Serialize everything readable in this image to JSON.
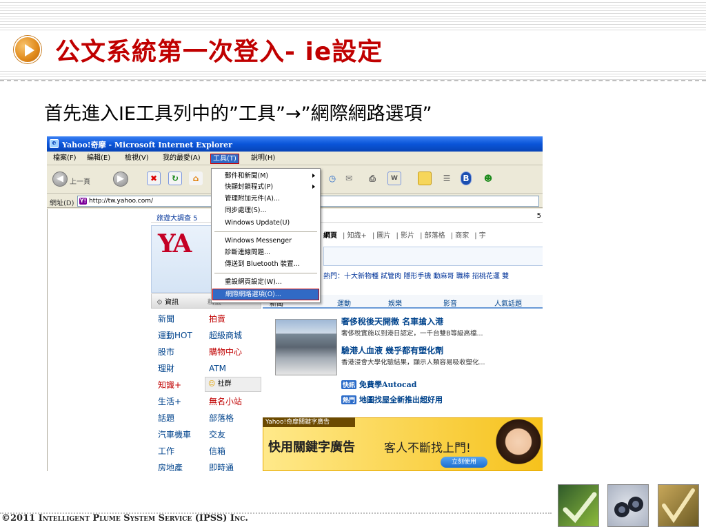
{
  "slide": {
    "title": "公文系統第一次登入- ie設定",
    "instruction": "首先進入IE工具列中的”工具”→”網際網路選項”",
    "footer": "©2011 Intelligent Plume System Service (IPSS) Inc."
  },
  "browser": {
    "window_title": "Yahoo!奇摩 - Microsoft Internet Explorer",
    "menu": [
      "檔案(F)",
      "編輯(E)",
      "檢視(V)",
      "我的最愛(A)",
      "工具(T)",
      "說明(H)"
    ],
    "toolbar": {
      "back_label": "上一頁"
    },
    "address": {
      "label": "網址(D)",
      "value": "http://tw.yahoo.com/"
    },
    "tools_menu": [
      {
        "label": "郵件和新聞(M)",
        "submenu": true
      },
      {
        "label": "快顯封鎖程式(P)",
        "submenu": true
      },
      {
        "label": "管理附加元件(A)..."
      },
      {
        "label": "同步處理(S)..."
      },
      {
        "label": "Windows Update(U)"
      },
      {
        "label": "Windows Messenger"
      },
      {
        "label": "診斷連線問題..."
      },
      {
        "label": "傳送到 Bluetooth 裝置..."
      },
      {
        "label": "重設網頁設定(W)..."
      },
      {
        "label": "網際網路選項(O)...",
        "highlighted": true
      }
    ]
  },
  "page": {
    "top_links": "旅遊大調查  5",
    "top_right": "5",
    "logo": "YA",
    "search_tabs": [
      "網頁",
      "知識+",
      "圖片",
      "影片",
      "部落格",
      "商家",
      "宇"
    ],
    "hot_line": "熱門：十大新物種 試管肉 隱形手機 動麻哥 職棒 招桃花運 雙",
    "categories_header": [
      "資訊",
      "精選"
    ],
    "left_column": [
      "新聞",
      "運動HOT",
      "股市",
      "理財",
      "知識+",
      "生活+",
      "話題",
      "汽車機車",
      "工作",
      "房地產"
    ],
    "right_column": [
      "拍賣",
      "超級商城",
      "購物中心",
      "ATM",
      "",
      "無名小站",
      "部落格",
      "交友",
      "信箱",
      "即時通"
    ],
    "community_label": "社群",
    "news_tabs": [
      "新聞",
      "運動",
      "娛樂",
      "影音",
      "人氣話題"
    ],
    "news": [
      {
        "headline": "奢侈稅後天開徵 名車搶入港",
        "sub": "奢侈稅實施以到港日認定，一千台雙B等級高檔..."
      },
      {
        "headline": "驗港人血液 幾乎都有塑化劑",
        "sub": "香港浸會大學化驗結果，顯示人類容易吸收塑化..."
      }
    ],
    "quick_links": [
      {
        "tag": "快訊",
        "text": "免費學Autocad"
      },
      {
        "tag": "熱門",
        "text": "地圖找屋全新推出超好用"
      }
    ],
    "ad": {
      "tag": "Yahoo!奇摩關鍵字廣告",
      "title": "快用關鍵字廣告",
      "subtitle": "客人不斷找上門!",
      "button": "立刻使用"
    }
  },
  "colors": {
    "title_red": "#c00000",
    "xp_blue": "#0a55d9",
    "menu_highlight": "#316ac5"
  }
}
